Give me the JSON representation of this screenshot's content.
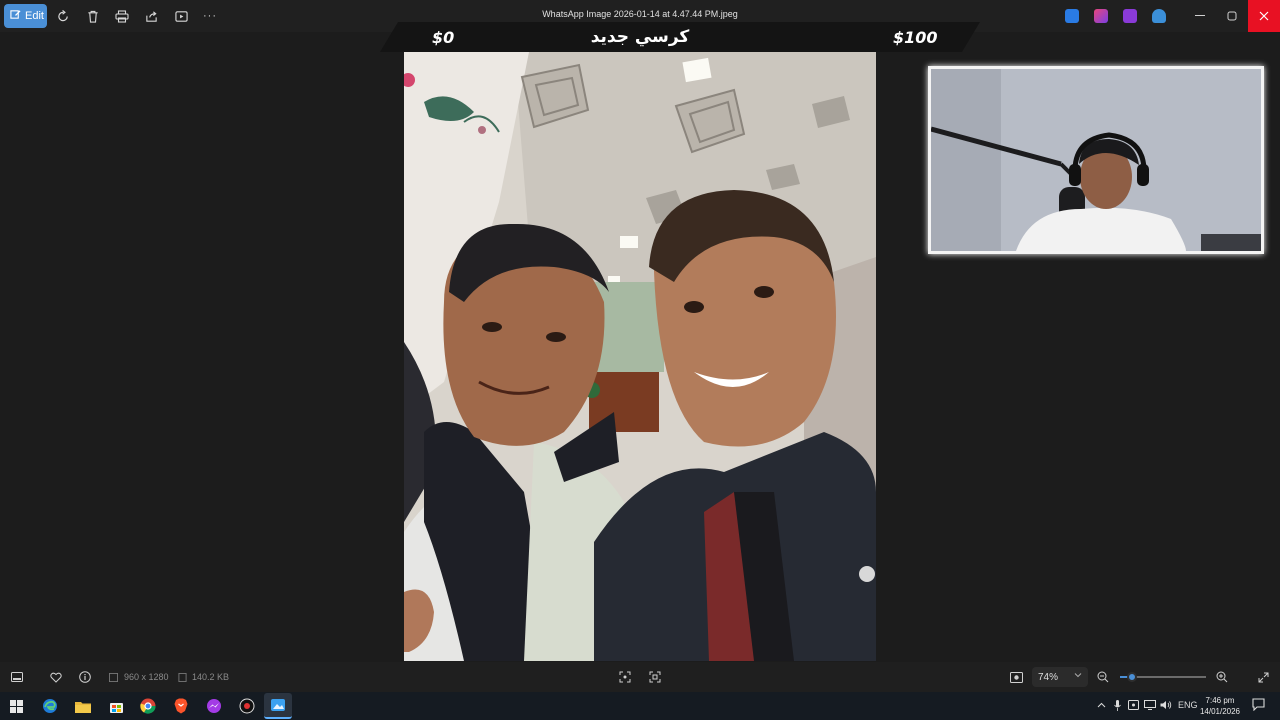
{
  "window": {
    "title": "WhatsApp Image 2026-01-14 at 4.47.44 PM.jpeg",
    "edit_label": "Edit",
    "toolbar_icons": [
      "rotate-icon",
      "delete-icon",
      "print-icon",
      "share-icon",
      "slideshow-icon",
      "more-icon"
    ],
    "more_label": "···"
  },
  "overlay": {
    "left_amount": "$0",
    "center_text": "كرسي جديد",
    "right_amount": "$100"
  },
  "bottom_bar": {
    "dimensions": "960 x 1280",
    "file_size": "140.2 KB",
    "zoom": "74%",
    "zoom_fraction": 0.14
  },
  "taskbar": {
    "language": "ENG",
    "time": "7:46 pm",
    "date": "14/01/2026"
  },
  "colors": {
    "accent": "#4a8fd6",
    "close": "#e81123"
  }
}
